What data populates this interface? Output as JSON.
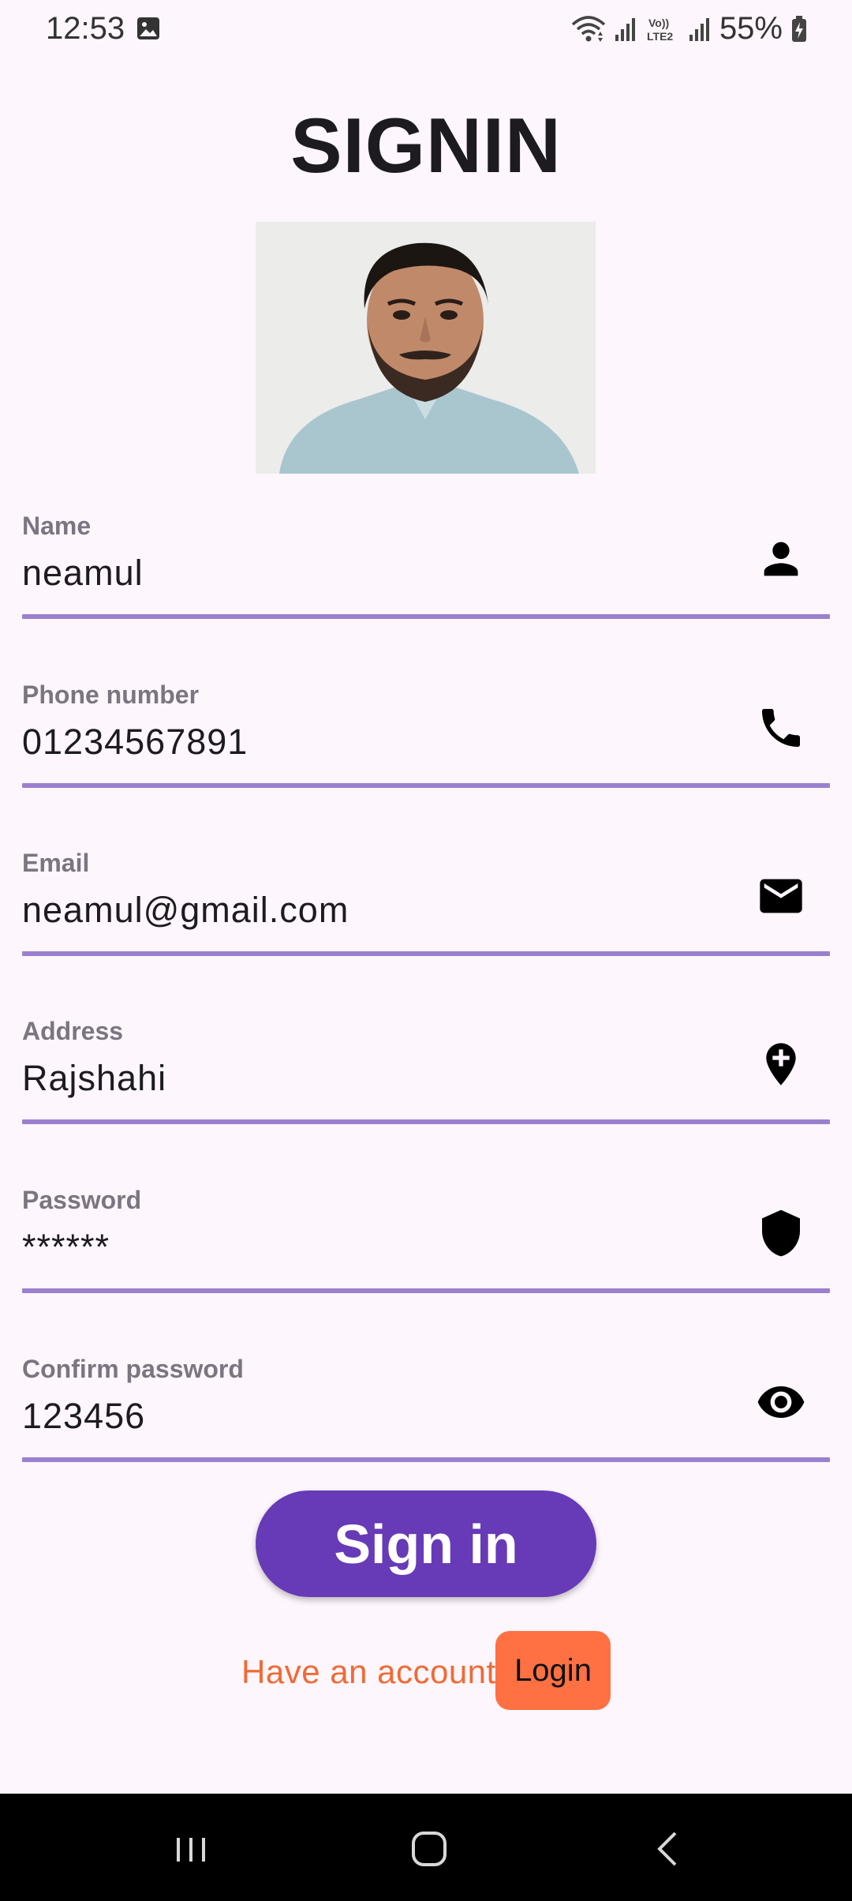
{
  "status_bar": {
    "time": "12:53",
    "battery": "55%",
    "network_label": "Vo)) LTE2",
    "icons": [
      "gallery-icon",
      "wifi-icon",
      "signal-icon",
      "volte-icon",
      "signal-icon",
      "battery-charging-icon"
    ]
  },
  "page": {
    "title": "SIGNIN"
  },
  "form": {
    "fields": [
      {
        "label": "Name",
        "value": "neamul",
        "icon": "person-icon"
      },
      {
        "label": "Phone number",
        "value": "01234567891",
        "icon": "phone-icon"
      },
      {
        "label": "Email",
        "value": "neamul@gmail.com",
        "icon": "mail-icon"
      },
      {
        "label": "Address",
        "value": "Rajshahi",
        "icon": "add-location-icon"
      },
      {
        "label": "Password",
        "value": "******",
        "icon": "shield-icon"
      },
      {
        "label": "Confirm password",
        "value": "123456",
        "icon": "eye-icon"
      }
    ]
  },
  "actions": {
    "signin_label": "Sign in",
    "account_prompt": "Have an account?",
    "login_label": "Login"
  },
  "colors": {
    "background": "#fdf6fc",
    "accent": "#673ab7",
    "underline": "#9b80cf",
    "login_button": "#ff7043",
    "prompt_text": "#f06a36"
  },
  "nav_bar": {
    "buttons": [
      "recent-apps-icon",
      "home-icon",
      "back-icon"
    ]
  }
}
